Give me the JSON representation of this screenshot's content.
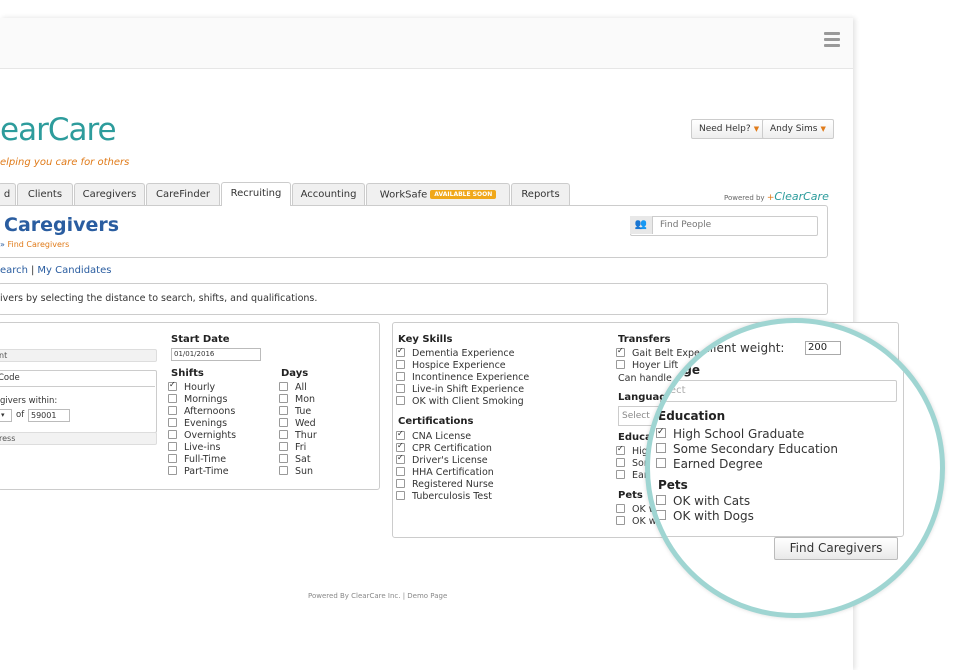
{
  "brand": {
    "logo_text": "earCare",
    "tagline": "elping you care for others"
  },
  "topbar": {
    "help_label": "Need Help?",
    "user_label": "Andy Sims"
  },
  "powered": {
    "prefix": "Powered by",
    "brand": "ClearCare"
  },
  "tabs": [
    {
      "label": "d",
      "active": false
    },
    {
      "label": "Clients",
      "active": false
    },
    {
      "label": "Caregivers",
      "active": false
    },
    {
      "label": "CareFinder",
      "active": false
    },
    {
      "label": "Recruiting",
      "active": true
    },
    {
      "label": "Accounting",
      "active": false
    },
    {
      "label": "WorkSafe",
      "badge": "AVAILABLE SOON",
      "active": false
    },
    {
      "label": "Reports",
      "active": false
    }
  ],
  "header": {
    "title": "Caregivers",
    "breadcrumb_sep": "»",
    "breadcrumb_current": "Find Caregivers"
  },
  "search": {
    "placeholder": "Find People"
  },
  "links": {
    "search": "earch",
    "my_candidates": "My Candidates",
    "sep": "|"
  },
  "instructions": "ivers by selecting the distance to search, shifts, and qualifications.",
  "left": {
    "bar1": "nt",
    "code_label": "Code",
    "within_label": "givers within:",
    "of_label": "of",
    "zip_value": "59001",
    "bar2": "ress",
    "start_date_label": "Start Date",
    "start_date_value": "01/01/2016",
    "shifts_label": "Shifts",
    "shifts": [
      {
        "label": "Hourly",
        "checked": true
      },
      {
        "label": "Mornings",
        "checked": false
      },
      {
        "label": "Afternoons",
        "checked": false
      },
      {
        "label": "Evenings",
        "checked": false
      },
      {
        "label": "Overnights",
        "checked": false
      },
      {
        "label": "Live-ins",
        "checked": false
      },
      {
        "label": "Full-Time",
        "checked": false
      },
      {
        "label": "Part-Time",
        "checked": false
      }
    ],
    "days_label": "Days",
    "days": [
      {
        "label": "All",
        "checked": false
      },
      {
        "label": "Mon",
        "checked": false
      },
      {
        "label": "Tue",
        "checked": false
      },
      {
        "label": "Wed",
        "checked": false
      },
      {
        "label": "Thur",
        "checked": false
      },
      {
        "label": "Fri",
        "checked": false
      },
      {
        "label": "Sat",
        "checked": false
      },
      {
        "label": "Sun",
        "checked": false
      }
    ]
  },
  "right": {
    "key_skills_label": "Key Skills",
    "key_skills": [
      {
        "label": "Dementia Experience",
        "checked": true
      },
      {
        "label": "Hospice Experience",
        "checked": false
      },
      {
        "label": "Incontinence Experience",
        "checked": false
      },
      {
        "label": "Live-in Shift Experience",
        "checked": false
      },
      {
        "label": "OK with Client Smoking",
        "checked": false
      }
    ],
    "certifications_label": "Certifications",
    "certifications": [
      {
        "label": "CNA License",
        "checked": true
      },
      {
        "label": "CPR Certification",
        "checked": true
      },
      {
        "label": "Driver's License",
        "checked": true
      },
      {
        "label": "HHA Certification",
        "checked": false
      },
      {
        "label": "Registered Nurse",
        "checked": false
      },
      {
        "label": "Tuberculosis Test",
        "checked": false
      }
    ],
    "transfers_label": "Transfers",
    "transfers": [
      {
        "label": "Gait Belt Expe",
        "checked": true
      },
      {
        "label": "Hoyer Lift",
        "checked": false
      }
    ],
    "can_handle": "Can handle",
    "language_label": "Languag",
    "select_short": "Select",
    "education_short": "Educa",
    "edu_partial": [
      {
        "label": "Hig",
        "checked": true
      },
      {
        "label": "Sor",
        "checked": false
      },
      {
        "label": "Ear",
        "checked": false
      }
    ],
    "pets_label": "Pets",
    "pets_partial": [
      {
        "label": "OK w",
        "checked": false
      },
      {
        "label": "OK w",
        "checked": false
      }
    ]
  },
  "magnifier": {
    "weight_label": "e client weight:",
    "weight_value": "200",
    "language_label": "guage",
    "language_placeholder": "elect",
    "education_label": "Education",
    "education": [
      {
        "label": "High School Graduate",
        "checked": true
      },
      {
        "label": "Some Secondary Education",
        "checked": false
      },
      {
        "label": "Earned Degree",
        "checked": false
      }
    ],
    "pets_label": "Pets",
    "pets": [
      {
        "label": "OK with Cats",
        "checked": false
      },
      {
        "label": "OK with Dogs",
        "checked": false
      }
    ]
  },
  "find_button": "Find Caregivers",
  "footer": "Powered By ClearCare Inc. | Demo Page",
  "colors": {
    "brand_teal": "#2d9c9c",
    "accent_orange": "#e07b1a",
    "link_blue": "#2a5da0",
    "magnifier_ring": "#9fd5d2"
  }
}
